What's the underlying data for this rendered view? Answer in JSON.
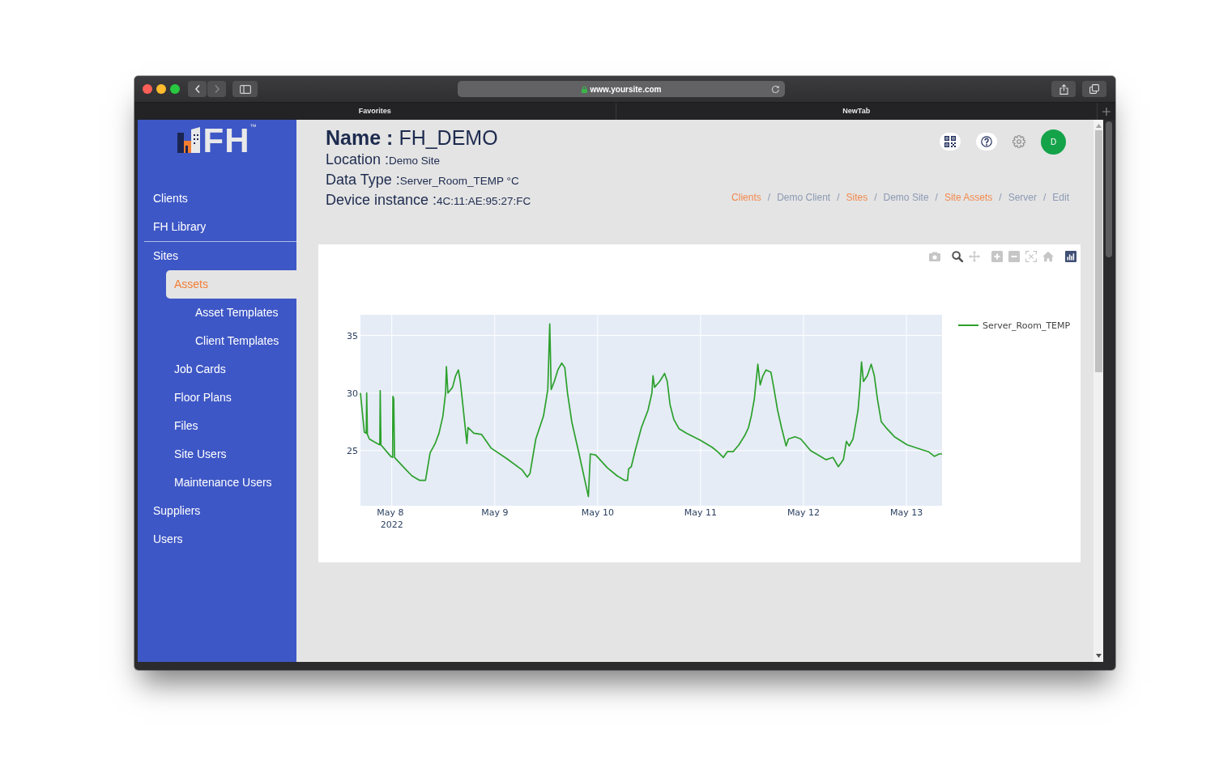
{
  "browser": {
    "nav_buttons": [
      {
        "kind": "back",
        "disabled": false
      },
      {
        "kind": "forward",
        "disabled": true
      }
    ],
    "url": "www.yoursite.com",
    "tabs": [
      {
        "label": "Favorites"
      },
      {
        "label": "NewTab"
      }
    ]
  },
  "sidebar": {
    "logo": {
      "text": "FH$^{™}$"
    },
    "groups": [
      {
        "items": [
          {
            "label": "Clients",
            "selected": false
          },
          {
            "label": "FH Library",
            "selected": false
          }
        ]
      },
      {
        "items": [
          {
            "label": "Sites",
            "selected": false,
            "children": [
              {
                "label": "Assets",
                "selected": true,
                "children": [
                  {
                    "label": "Asset Templates",
                    "selected": false
                  },
                  {
                    "label": "Client Templates",
                    "selected": false
                  }
                ]
              },
              {
                "label": "Job Cards",
                "selected": false
              },
              {
                "label": "Floor Plans",
                "selected": false
              },
              {
                "label": "Files",
                "selected": false
              },
              {
                "label": "Site Users",
                "selected": false
              },
              {
                "label": "Maintenance Users",
                "selected": false
              }
            ]
          },
          {
            "label": "Suppliers",
            "selected": false
          },
          {
            "label": "Users",
            "selected": false
          }
        ]
      }
    ]
  },
  "header": {
    "name_label": "Name :",
    "name": "FH_DEMO",
    "fields": [
      {
        "label": "Location :",
        "value": "Demo Site"
      },
      {
        "label": "Data Type :",
        "value": "Server_Room_TEMP °C"
      },
      {
        "label": "Device instance :",
        "value": "4C:11:AE:95:27:FC"
      }
    ]
  },
  "user": {
    "initial": "D"
  },
  "breadcrumb": [
    {
      "label": "Clients",
      "link": true,
      "separator": "/"
    },
    {
      "label": "Demo Client",
      "link": false,
      "separator": "/"
    },
    {
      "label": "Sites",
      "link": true,
      "separator": "/"
    },
    {
      "label": "Demo Site",
      "link": false,
      "separator": "/"
    },
    {
      "label": "Site Assets",
      "link": true,
      "separator": "/"
    },
    {
      "label": "Server",
      "link": false,
      "separator": "/"
    },
    {
      "label": "Edit",
      "link": false
    }
  ],
  "chart": {
    "modebar": [
      {
        "tools": [
          {
            "kind": "camera",
            "selected": false
          }
        ]
      },
      {
        "tools": [
          {
            "kind": "zoom",
            "selected": true
          },
          {
            "kind": "pan",
            "selected": false
          }
        ]
      },
      {
        "tools": [
          {
            "kind": "zoom_in",
            "selected": false
          },
          {
            "kind": "zoom_out",
            "selected": false
          },
          {
            "kind": "autoscale",
            "selected": false
          },
          {
            "kind": "home",
            "selected": false
          }
        ]
      },
      {
        "tools": [
          {
            "kind": "logo"
          }
        ]
      }
    ],
    "chart_data": {
      "type": "line",
      "grid": true,
      "x": [
        "2022-05-07 16:41",
        "2022-05-07 17:14",
        "2022-05-07 17:35",
        "2022-05-07 18:03",
        "2022-05-07 18:08",
        "2022-05-07 18:19",
        "2022-05-07 18:46",
        "2022-05-07 20:07",
        "2022-05-07 21:12",
        "2022-05-07 21:17",
        "2022-05-07 21:28",
        "2022-05-07 23:44",
        "2022-05-08 00:11",
        "2022-05-08 00:16",
        "2022-05-08 00:27",
        "2022-05-08 00:38",
        "2022-05-08 02:53",
        "2022-05-08 04:41",
        "2022-05-08 06:30",
        "2022-05-08 07:51",
        "2022-05-08 08:56",
        "2022-05-08 10:06",
        "2022-05-08 11:00",
        "2022-05-08 11:55",
        "2022-05-08 12:32",
        "2022-05-08 12:43",
        "2022-05-08 13:05",
        "2022-05-08 14:10",
        "2022-05-08 14:53",
        "2022-05-08 15:31",
        "2022-05-08 15:58",
        "2022-05-08 16:41",
        "2022-05-08 17:30",
        "2022-05-08 17:46",
        "2022-05-08 19:08",
        "2022-05-08 20:56",
        "2022-05-08 23:11",
        "2022-05-09 02:48",
        "2022-05-09 06:25",
        "2022-05-09 07:35",
        "2022-05-09 08:13",
        "2022-05-09 09:34",
        "2022-05-09 11:22",
        "2022-05-09 12:22",
        "2022-05-09 12:49",
        "2022-05-09 13:10",
        "2022-05-09 13:53",
        "2022-05-09 14:43",
        "2022-05-09 15:37",
        "2022-05-09 16:20",
        "2022-05-09 16:58",
        "2022-05-09 17:58",
        "2022-05-09 18:52",
        "2022-05-09 19:29",
        "2022-05-09 21:50",
        "2022-05-09 22:17",
        "2022-05-09 23:33",
        "2022-05-10 02:15",
        "2022-05-10 04:31",
        "2022-05-10 06:19",
        "2022-05-10 06:57",
        "2022-05-10 07:13",
        "2022-05-10 07:51",
        "2022-05-10 08:45",
        "2022-05-10 10:12",
        "2022-05-10 11:44",
        "2022-05-10 12:38",
        "2022-05-10 12:54",
        "2022-05-10 13:16",
        "2022-05-10 14:26",
        "2022-05-10 15:37",
        "2022-05-10 16:14",
        "2022-05-10 16:52",
        "2022-05-10 17:46",
        "2022-05-10 18:57",
        "2022-05-10 20:45",
        "2022-05-10 23:55",
        "2022-05-11 02:37",
        "2022-05-11 03:58",
        "2022-05-11 05:19",
        "2022-05-11 06:14",
        "2022-05-11 07:35",
        "2022-05-11 08:56",
        "2022-05-11 10:17",
        "2022-05-11 11:11",
        "2022-05-11 11:49",
        "2022-05-11 12:32",
        "2022-05-11 13:21",
        "2022-05-11 13:54",
        "2022-05-11 14:32",
        "2022-05-11 15:15",
        "2022-05-11 16:25",
        "2022-05-11 17:03",
        "2022-05-11 17:57",
        "2022-05-11 18:52",
        "2022-05-11 19:56",
        "2022-05-11 20:29",
        "2022-05-11 22:01",
        "2022-05-11 23:22",
        "2022-05-12 01:37",
        "2022-05-12 05:14",
        "2022-05-12 06:51",
        "2022-05-12 08:07",
        "2022-05-12 09:18",
        "2022-05-12 10:01",
        "2022-05-12 10:39",
        "2022-05-12 11:33",
        "2022-05-12 12:43",
        "2022-05-12 13:10",
        "2022-05-12 13:32",
        "2022-05-12 13:59",
        "2022-05-12 14:53",
        "2022-05-12 15:47",
        "2022-05-12 16:31",
        "2022-05-12 17:14",
        "2022-05-12 18:08",
        "2022-05-12 19:13",
        "2022-05-12 21:12",
        "2022-05-13 00:11",
        "2022-05-13 03:20",
        "2022-05-13 05:08",
        "2022-05-13 06:30",
        "2022-05-13 07:40",
        "2022-05-13 08:18"
      ],
      "series": [
        {
          "name": "Server_Room_TEMP",
          "color": "#2ca02c",
          "values": [
            30.0,
            27.9,
            26.6,
            26.5,
            30.0,
            26.4,
            26.0,
            25.7,
            25.5,
            30.2,
            25.5,
            24.5,
            24.4,
            29.7,
            29.5,
            24.4,
            23.5,
            22.8,
            22.4,
            22.4,
            24.8,
            25.6,
            26.5,
            28.0,
            30.0,
            32.3,
            30.0,
            30.5,
            31.5,
            32.0,
            31.0,
            28.5,
            25.6,
            27.0,
            26.5,
            26.4,
            25.2,
            24.3,
            23.3,
            22.7,
            23.0,
            26.0,
            28.0,
            30.3,
            36.0,
            30.3,
            31.0,
            32.0,
            32.6,
            32.2,
            30.0,
            27.5,
            26.0,
            25.0,
            21.0,
            24.7,
            24.6,
            23.5,
            22.8,
            22.4,
            22.4,
            23.4,
            23.6,
            25.0,
            27.0,
            28.5,
            30.0,
            31.5,
            30.5,
            31.0,
            31.7,
            31.0,
            29.0,
            27.7,
            26.9,
            26.5,
            25.9,
            25.3,
            24.9,
            24.4,
            24.9,
            24.9,
            25.5,
            26.3,
            27.0,
            28.0,
            29.5,
            32.5,
            30.7,
            31.5,
            32.0,
            31.8,
            30.5,
            28.5,
            27.0,
            25.4,
            26.0,
            26.2,
            26.0,
            25.0,
            24.2,
            24.4,
            23.6,
            24.2,
            25.8,
            25.4,
            26.0,
            28.5,
            30.5,
            32.7,
            31.0,
            31.5,
            32.5,
            31.5,
            29.5,
            27.5,
            27.0,
            26.2,
            25.5,
            25.1,
            24.9,
            24.5,
            24.7,
            24.7
          ]
        }
      ],
      "xlim": [
        "2022-05-07 16:41",
        "2022-05-13 08:18"
      ],
      "ylim": [
        20.2,
        36.8
      ],
      "xticks": [
        {
          "value": "2022-05-08",
          "label": "May 8\n2022"
        },
        {
          "value": "2022-05-09",
          "label": "May 9"
        },
        {
          "value": "2022-05-10",
          "label": "May 10"
        },
        {
          "value": "2022-05-11",
          "label": "May 11"
        },
        {
          "value": "2022-05-12",
          "label": "May 12"
        },
        {
          "value": "2022-05-13",
          "label": "May 13"
        }
      ],
      "yticks": [
        25,
        30,
        35
      ]
    }
  }
}
